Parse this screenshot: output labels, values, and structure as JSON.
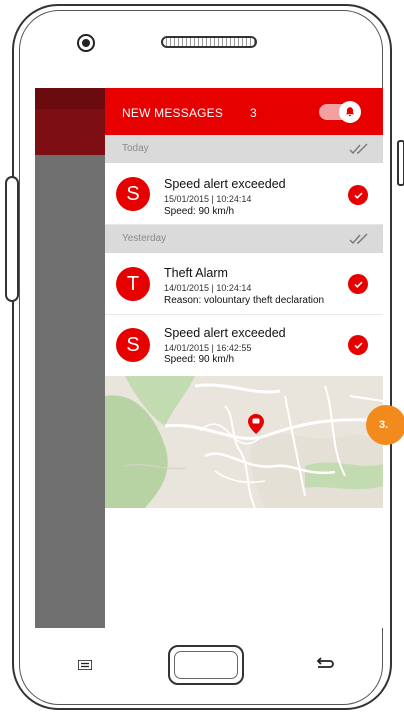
{
  "header": {
    "title": "NEW MESSAGES",
    "count": "3"
  },
  "sections": {
    "today": "Today",
    "yesterday": "Yesterday"
  },
  "messages": [
    {
      "initial": "S",
      "title": "Speed alert exceeded",
      "date": "15/01/2015 | 10:24:14",
      "detail": "Speed: 90 km/h"
    },
    {
      "initial": "T",
      "title": "Theft Alarm",
      "date": "14/01/2015 | 10:24:14",
      "detail": "Reason: volountary theft declaration"
    },
    {
      "initial": "S",
      "title": "Speed alert exceeded",
      "date": "14/01/2015 | 16:42:55",
      "detail": "Speed: 90 km/h"
    }
  ],
  "badge": {
    "label": "3."
  },
  "colors": {
    "brand": "#e60000",
    "badge": "#f28a1e",
    "drawer": "#707070"
  },
  "icons": [
    "bell-icon",
    "double-check-icon",
    "check-icon",
    "map-pin-icon",
    "menu-icon",
    "back-icon"
  ]
}
